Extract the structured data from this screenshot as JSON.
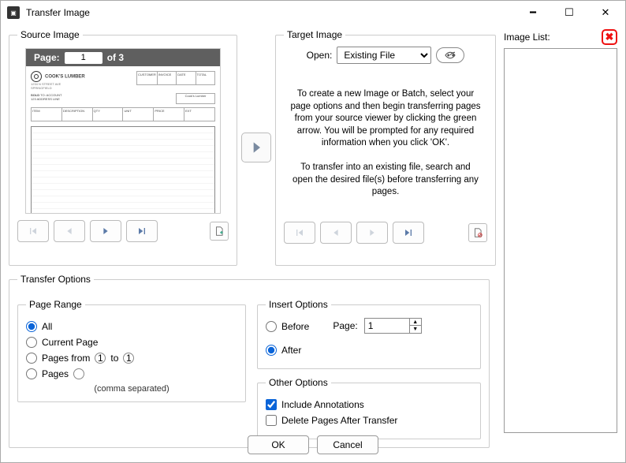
{
  "window": {
    "title": "Transfer Image"
  },
  "source": {
    "legend": "Source Image",
    "page_label": "Page:",
    "page_num": "1",
    "of_label": "of",
    "total_pages": "3",
    "doc_title": "COOK'S LUMBER"
  },
  "target": {
    "legend": "Target Image",
    "open_label": "Open:",
    "open_value": "Existing File",
    "message_1": "To create a new Image or Batch, select your page options and then begin transferring pages from your source viewer by clicking the green arrow. You will be prompted for any required information when you click 'OK'.",
    "message_2": "To transfer into an existing file, search and open the desired file(s) before transferring any pages."
  },
  "image_list": {
    "label": "Image List:"
  },
  "transfer_options": {
    "legend": "Transfer Options",
    "page_range": {
      "legend": "Page Range",
      "all": "All",
      "current": "Current Page",
      "pages_from": "Pages from",
      "to": "to",
      "from_val": "1",
      "to_val": "1",
      "pages": "Pages",
      "hint": "(comma separated)",
      "selected": "all"
    },
    "insert": {
      "legend": "Insert Options",
      "before": "Before",
      "after": "After",
      "page_label": "Page:",
      "page_val": "1",
      "selected": "after"
    },
    "other": {
      "legend": "Other Options",
      "include_ann": "Include Annotations",
      "delete_after": "Delete Pages After Transfer",
      "include_checked": true,
      "delete_checked": false
    }
  },
  "buttons": {
    "ok": "OK",
    "cancel": "Cancel"
  }
}
